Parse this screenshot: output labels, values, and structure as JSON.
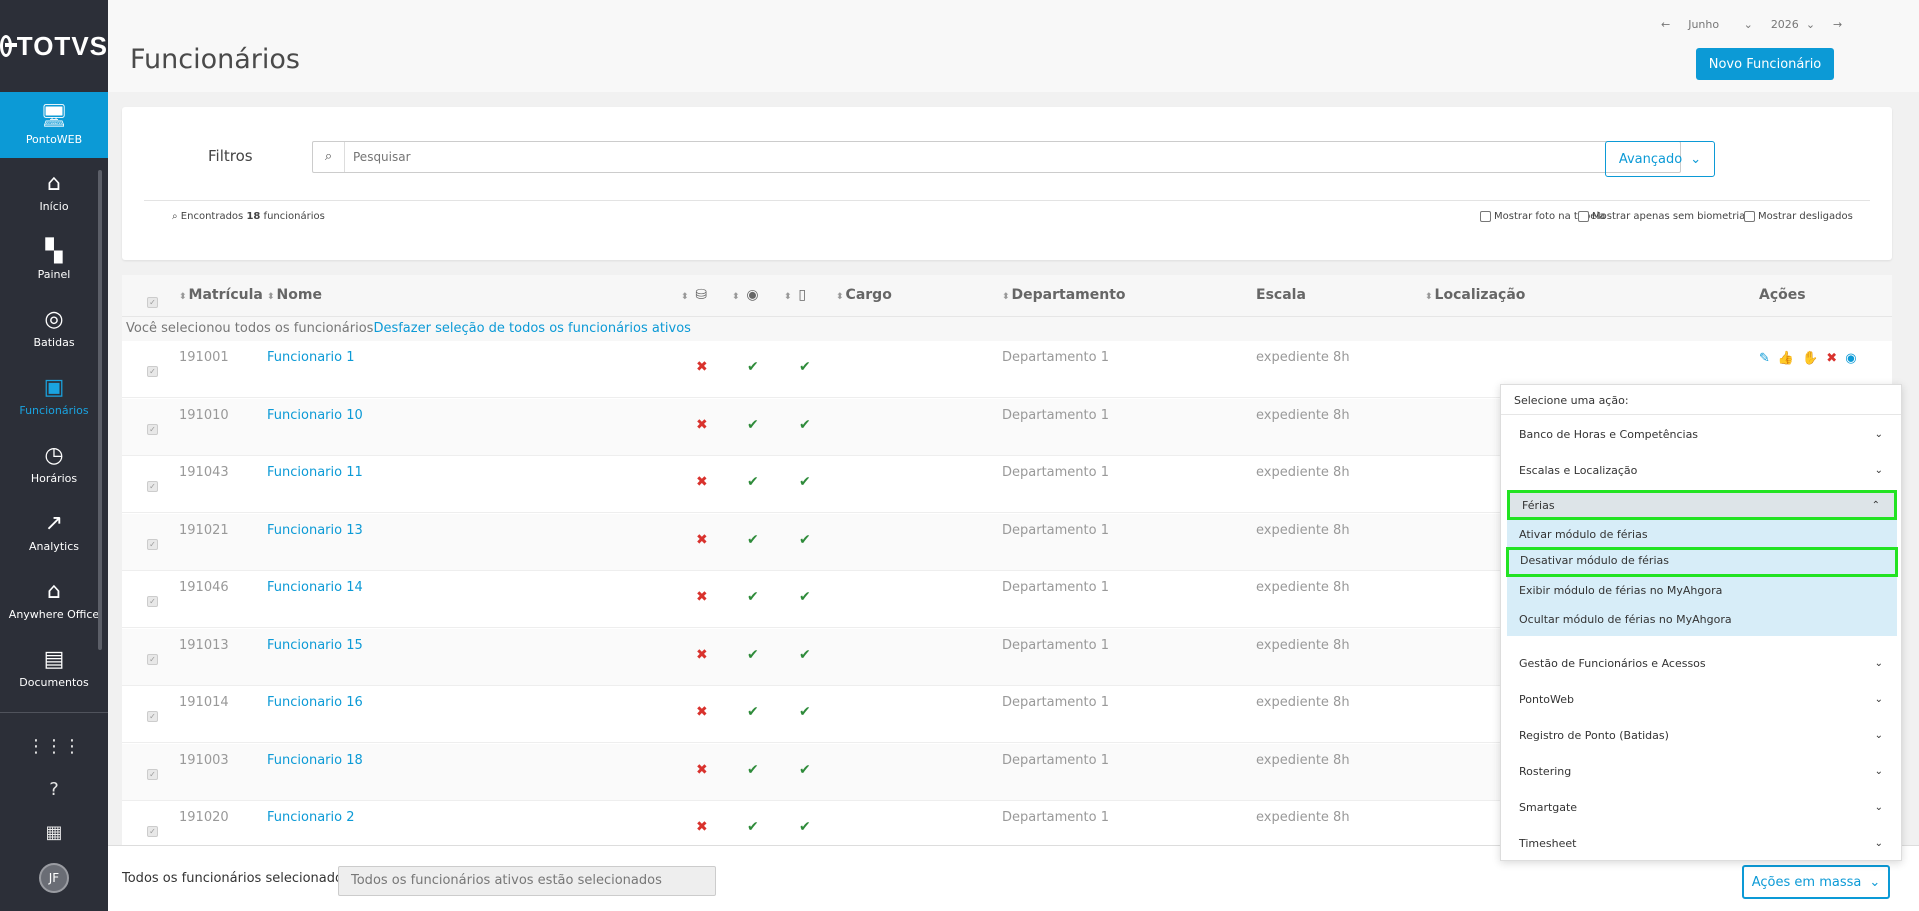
{
  "brand": {
    "logo_text": "TOTVS"
  },
  "sidebar": {
    "items": [
      {
        "label": "PontoWEB",
        "icon": "monitor-icon"
      },
      {
        "label": "Início",
        "icon": "home-icon"
      },
      {
        "label": "Painel",
        "icon": "dashboard-icon"
      },
      {
        "label": "Batidas",
        "icon": "fingerprint-icon"
      },
      {
        "label": "Funcionários",
        "icon": "badge-icon"
      },
      {
        "label": "Horários",
        "icon": "clock-icon"
      },
      {
        "label": "Analytics",
        "icon": "trend-icon"
      },
      {
        "label": "Anywhere Office",
        "icon": "building-icon"
      },
      {
        "label": "Documentos",
        "icon": "document-icon"
      }
    ],
    "avatar_initials": "JF"
  },
  "header": {
    "title": "Funcionários",
    "month": "Junho",
    "year": "2026",
    "new_button": "Novo Funcionário"
  },
  "filters": {
    "label": "Filtros",
    "search_placeholder": "Pesquisar",
    "advanced": "Avançado",
    "found_prefix": "Encontrados",
    "found_count": "18",
    "found_suffix": "funcionários",
    "options": [
      "Mostrar foto na tabela",
      "Mostrar apenas sem biometria",
      "Mostrar desligados"
    ]
  },
  "table": {
    "headers": {
      "matricula": "Matrícula",
      "nome": "Nome",
      "cargo": "Cargo",
      "departamento": "Departamento",
      "escala": "Escala",
      "localizacao": "Localização",
      "acoes": "Ações"
    },
    "selection_banner": "Você selecionou todos os funcionários",
    "undo_selection": "Desfazer seleção de todos os funcionários ativos",
    "rows": [
      {
        "matricula": "191001",
        "nome": "Funcionario 1",
        "departamento": "Departamento 1",
        "escala": "expediente 8h"
      },
      {
        "matricula": "191010",
        "nome": "Funcionario 10",
        "departamento": "Departamento 1",
        "escala": "expediente 8h"
      },
      {
        "matricula": "191043",
        "nome": "Funcionario 11",
        "departamento": "Departamento 1",
        "escala": "expediente 8h"
      },
      {
        "matricula": "191021",
        "nome": "Funcionario 13",
        "departamento": "Departamento 1",
        "escala": "expediente 8h"
      },
      {
        "matricula": "191046",
        "nome": "Funcionario 14",
        "departamento": "Departamento 1",
        "escala": "expediente 8h"
      },
      {
        "matricula": "191013",
        "nome": "Funcionario 15",
        "departamento": "Departamento 1",
        "escala": "expediente 8h"
      },
      {
        "matricula": "191014",
        "nome": "Funcionario 16",
        "departamento": "Departamento 1",
        "escala": "expediente 8h"
      },
      {
        "matricula": "191003",
        "nome": "Funcionario 18",
        "departamento": "Departamento 1",
        "escala": "expediente 8h"
      },
      {
        "matricula": "191020",
        "nome": "Funcionario 2",
        "departamento": "Departamento 1",
        "escala": "expediente 8h"
      }
    ]
  },
  "action_menu": {
    "title": "Selecione uma ação:",
    "groups": [
      "Banco de Horas e Competências",
      "Escalas e Localização",
      "Férias",
      "Gestão de Funcionários e Acessos",
      "PontoWeb",
      "Registro de Ponto (Batidas)",
      "Rostering",
      "Smartgate",
      "Timesheet"
    ],
    "ferias_items": [
      "Ativar módulo de férias",
      "Desativar módulo de férias",
      "Exibir módulo de férias no MyAhgora",
      "Ocultar módulo de férias no MyAhgora"
    ]
  },
  "bottom_bar": {
    "label": "Todos os funcionários selecionados",
    "input_value": "Todos os funcionários ativos estão selecionados",
    "mass_actions": "Ações em massa"
  },
  "colors": {
    "accent": "#0c9ad6",
    "sidebar": "#2c2f38",
    "highlight": "#22e322",
    "error": "#d9322d",
    "ok": "#2e8b3a"
  }
}
